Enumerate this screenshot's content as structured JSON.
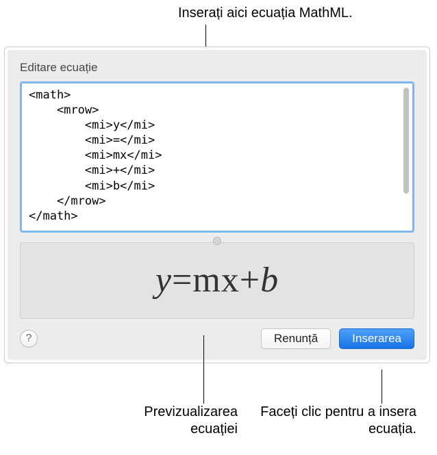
{
  "callouts": {
    "top": "Inserați aici ecuația MathML.",
    "bottom_left": "Previzualizarea ecuației",
    "bottom_right": "Faceți clic pentru a insera ecuația."
  },
  "dialog": {
    "title": "Editare ecuație",
    "code": "<math>\n    <mrow>\n        <mi>y</mi>\n        <mi>=</mi>\n        <mi>mx</mi>\n        <mi>+</mi>\n        <mi>b</mi>\n    </mrow>\n</math>",
    "preview_expression": {
      "y": "y",
      "eq": "=",
      "mx": "mx",
      "plus": "+",
      "b": "b"
    },
    "help_label": "?",
    "cancel_label": "Renunță",
    "insert_label": "Inserarea"
  }
}
